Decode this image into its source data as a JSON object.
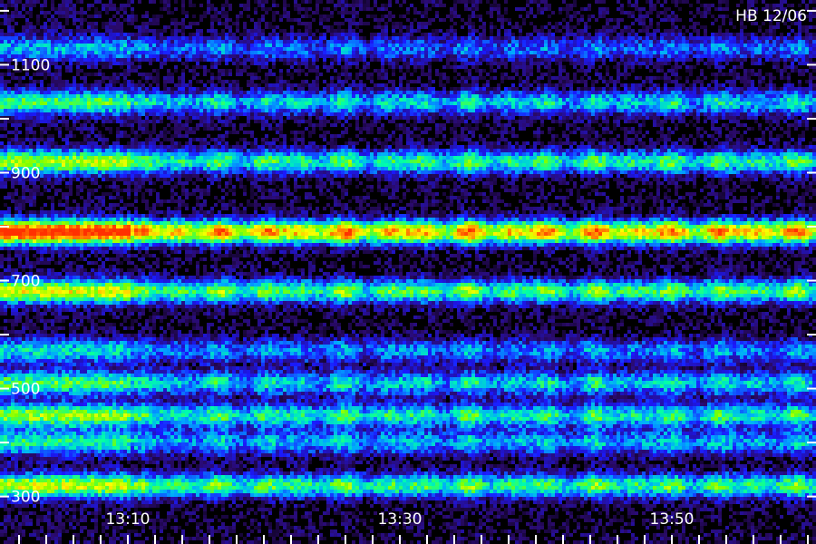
{
  "chart_data": {
    "type": "heatmap",
    "title": "HB 12/06",
    "y_ticks": [
      1100,
      900,
      700,
      500,
      300
    ],
    "x_ticks": [
      "13:10",
      "13:30",
      "13:50"
    ],
    "ylim": [
      212,
      1220
    ],
    "xlim_minutes": [
      12.6,
      72.6
    ],
    "data_start_minutes": 22,
    "gap_minutes": [
      [
        10.2,
        11.4
      ]
    ],
    "bands": [
      {
        "freq": 1130,
        "intensity": 0.3
      },
      {
        "freq": 1030,
        "intensity": 0.45
      },
      {
        "freq": 920,
        "intensity": 0.55
      },
      {
        "freq": 790,
        "intensity": 0.9
      },
      {
        "freq": 680,
        "intensity": 0.6
      },
      {
        "freq": 570,
        "intensity": 0.35
      },
      {
        "freq": 510,
        "intensity": 0.45
      },
      {
        "freq": 450,
        "intensity": 0.52
      },
      {
        "freq": 400,
        "intensity": 0.4
      },
      {
        "freq": 320,
        "intensity": 0.58
      }
    ],
    "colormap": [
      "#000000",
      "#2a0a6a",
      "#1a1aff",
      "#00a8ff",
      "#00ffaa",
      "#7cff00",
      "#ffff00",
      "#ff8000",
      "#ff3000"
    ],
    "grid": false,
    "legend": "none"
  }
}
